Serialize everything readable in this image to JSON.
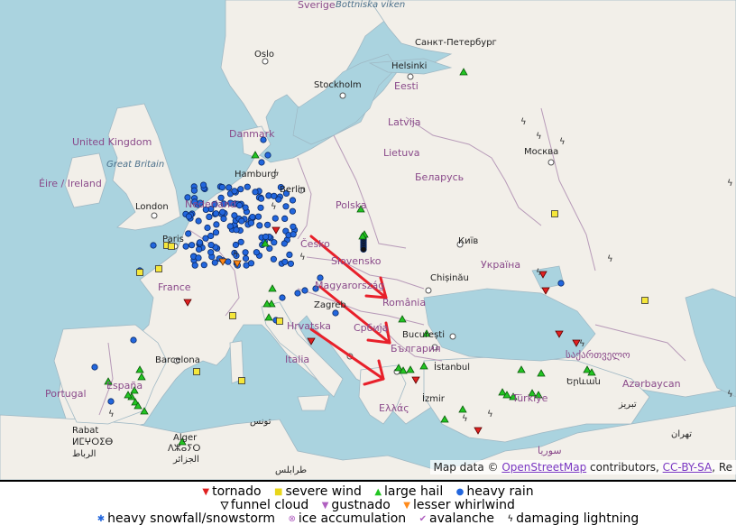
{
  "map": {
    "labels": {
      "sverige": "Sverige",
      "bottniska_viken": "Bottniska viken",
      "oslo": "Oslo",
      "helsinki": "Helsinki",
      "sankt_peterburg": "Санкт-Петербург",
      "stockholm": "Stockholm",
      "eesti": "Eesti",
      "latvija": "Latvija",
      "lietuva": "Lietuva",
      "moskva": "Москва",
      "united_kingdom": "United Kingdom",
      "great_britain": "Great Britain",
      "eire": "Éire / Ireland",
      "danmark": "Danmark",
      "hamburg": "Hamburg",
      "berlin": "Berlin",
      "nederland": "Nederland",
      "london": "London",
      "polska": "Polska",
      "belarus": "Беларусь",
      "kyiv": "Київ",
      "ukraina": "Україна",
      "cesko": "Česko",
      "slovensko": "Slovensko",
      "magyarorszag": "Magyarország",
      "chisinau": "Chișinău",
      "paris": "Paris",
      "france": "France",
      "romania": "România",
      "zagreb": "Zagreb",
      "hrvatska": "Hrvatska",
      "srbija": "Србија",
      "bucuresti": "București",
      "bulgaria": "България",
      "italia": "Italia",
      "sakartvelo": "საქართველო",
      "yerevan": "Երևան",
      "azarbaycan": "Azərbaycan",
      "barcelona": "Barcelona",
      "portugal": "Portugal",
      "espana": "España",
      "istanbul": "İstanbul",
      "izmir": "İzmir",
      "turkiye": "Türkiye",
      "ellas": "Ελλάς",
      "rabat": "Rabat",
      "morocco_tif": "ⵍⵎⵖⵔⵉⴱ",
      "rabat_ar": "الرباط",
      "alger": "Alger",
      "alger_tif": "ⴷⵣⴰⵢⵔ",
      "alger_ar": "الجزائر",
      "tunis": "تونس",
      "tarabulus": "طرابلس",
      "tabriz": "تبریز",
      "tehran": "تهران",
      "suriya": "سوريا"
    },
    "attribution": {
      "prefix": "Map data ©",
      "osm_link": "OpenStreetMap",
      "middle": "contributors,",
      "license_link": "CC-BY-SA",
      "suffix": ", Re"
    }
  },
  "legend": {
    "row1": [
      "tornado",
      "severe wind",
      "large hail",
      "heavy rain"
    ],
    "row2": [
      "funnel cloud",
      "gustnado",
      "lesser whirlwind"
    ],
    "row3": [
      "heavy snowfall/snowstorm",
      "ice accumulation",
      "avalanche",
      "damaging lightning"
    ],
    "symbols": {
      "tornado": "▼",
      "severe_wind": "■",
      "large_hail": "▲",
      "heavy_rain": "●",
      "funnel_cloud": "▼",
      "gustnado": "▼",
      "lesser_whirlwind": "▼",
      "snow": "✱",
      "ice": "⊗",
      "avalanche": "✔",
      "lightning": "ϟ"
    }
  },
  "colors": {
    "sea": "#aad3df",
    "land": "#f2efe9",
    "border": "#b79ab8",
    "tornado": "#e02020",
    "wind": "#f5e63a",
    "hail": "#22c522",
    "rain": "#2266dd",
    "gustnado": "#b060c0",
    "whirlwind": "#ff8a1a",
    "arrow": "#e8202a"
  }
}
